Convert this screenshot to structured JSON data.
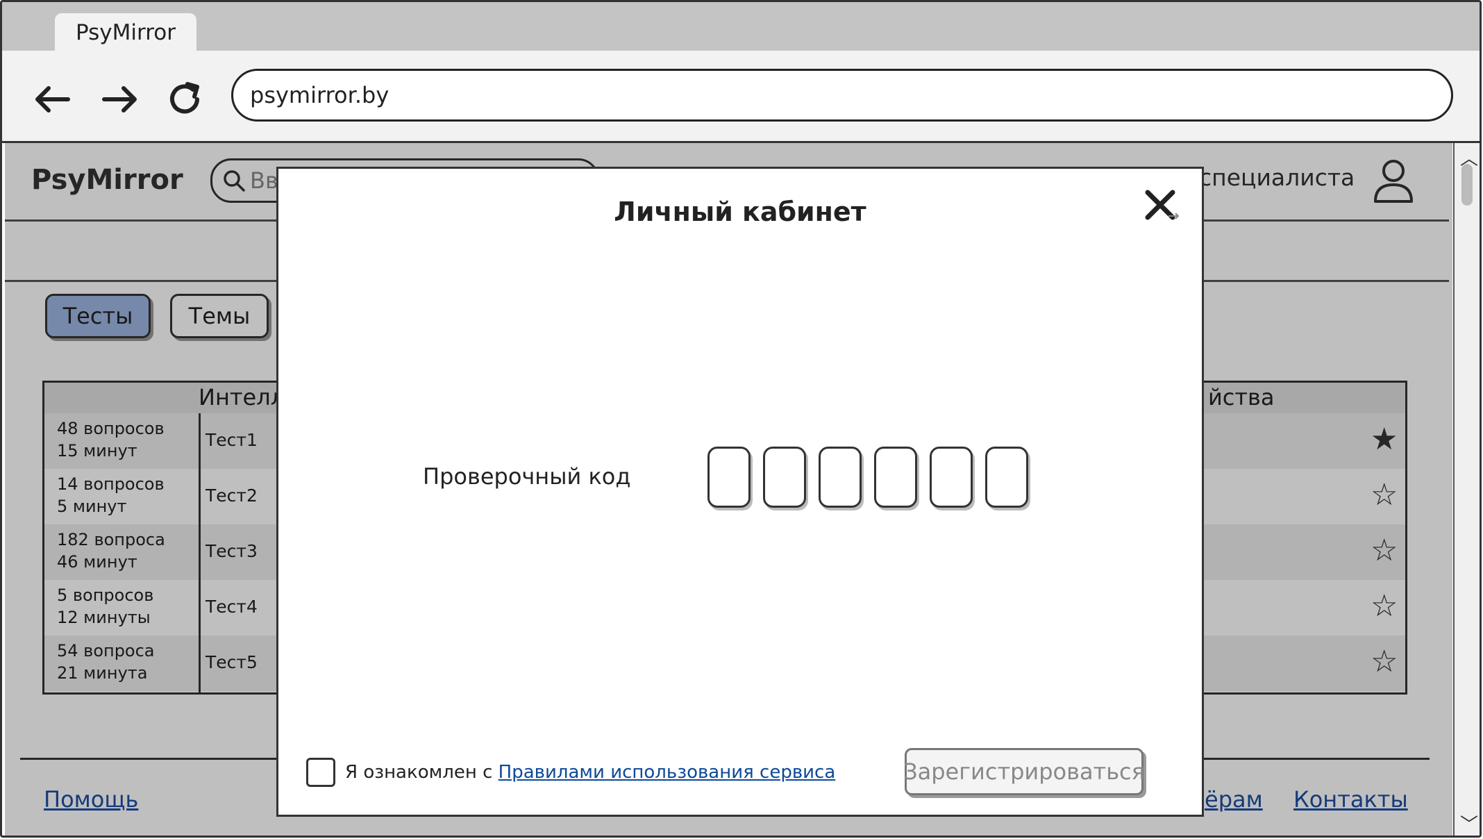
{
  "browser": {
    "tab_title": "PsyMirror",
    "url": "psymirror.by"
  },
  "header": {
    "logo": "PsyMirror",
    "search_placeholder": "Вв",
    "specialist_link": "специалиста"
  },
  "tabs": [
    {
      "label": "Тесты",
      "active": true
    },
    {
      "label": "Темы",
      "active": false
    }
  ],
  "table": {
    "header_left": "Интелл",
    "header_right": "йства",
    "rows": [
      {
        "questions": "48 вопросов",
        "time": "15 минут",
        "name": "Тест1",
        "favorite": true
      },
      {
        "questions": "14 вопросов",
        "time": "5 минут",
        "name": "Тест2",
        "favorite": false
      },
      {
        "questions": "182 вопроса",
        "time": "46 минут",
        "name": "Тест3",
        "favorite": false
      },
      {
        "questions": "5 вопросов",
        "time": "12 минуты",
        "name": "Тест4",
        "favorite": false
      },
      {
        "questions": "54 вопроса",
        "time": "21 минута",
        "name": "Тест5",
        "favorite": false
      }
    ]
  },
  "footer": {
    "help": "Помощь",
    "partners": "ёрам",
    "contacts": "Контакты"
  },
  "modal": {
    "title": "Личный кабинет",
    "code_label": "Проверочный код",
    "agree_prefix": "Я ознакомлен с ",
    "agree_link": "Правилами использования сервиса",
    "register": "Зарегистрироваться"
  },
  "colors": {
    "active_tab": "#9fb7e3",
    "link": "#1c4fa3"
  }
}
